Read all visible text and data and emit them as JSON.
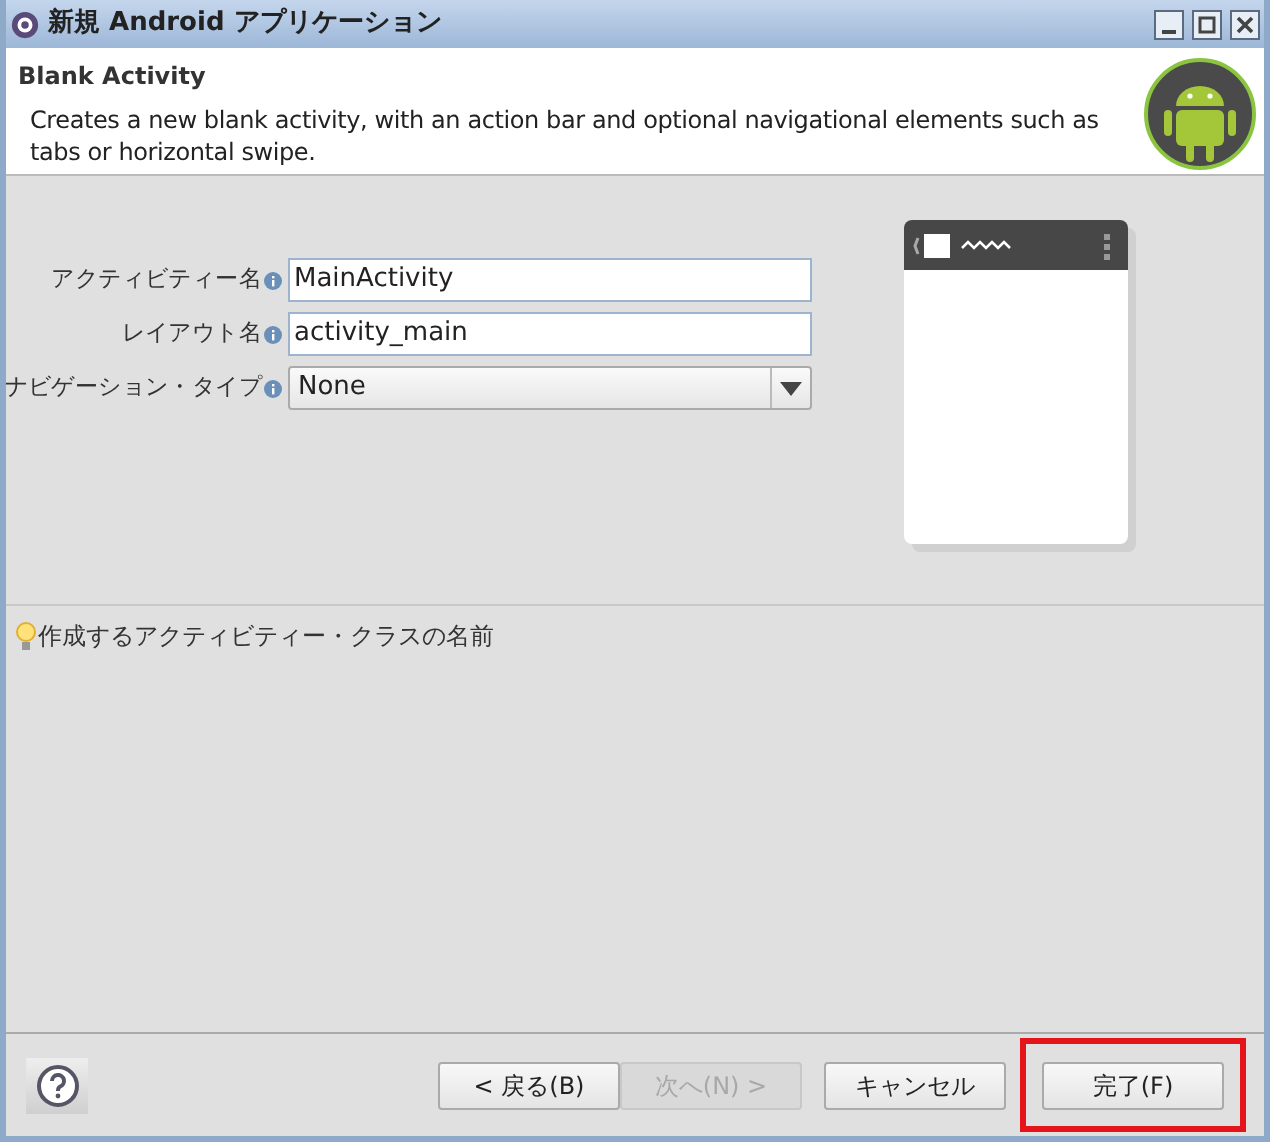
{
  "window": {
    "title": "新規 Android アプリケーション"
  },
  "header": {
    "title": "Blank Activity",
    "description": "Creates a new blank activity, with an action bar and optional navigational elements such as tabs or horizontal swipe."
  },
  "form": [
    {
      "kind": "text",
      "label": "アクティビティー名",
      "value": "MainActivity"
    },
    {
      "kind": "text",
      "label": "レイアウト名",
      "value": "activity_main"
    },
    {
      "kind": "select",
      "label": "ナビゲーション・タイプ",
      "value": "None"
    }
  ],
  "hint": "作成するアクティビティー・クラスの名前",
  "buttons": [
    {
      "label": "< 戻る(B)",
      "disabled": false,
      "highlighted": false
    },
    {
      "label": "次へ(N) >",
      "disabled": true,
      "highlighted": false
    },
    {
      "label": "キャンセル",
      "disabled": false,
      "highlighted": false
    },
    {
      "label": "完了(F)",
      "disabled": false,
      "highlighted": true
    }
  ]
}
